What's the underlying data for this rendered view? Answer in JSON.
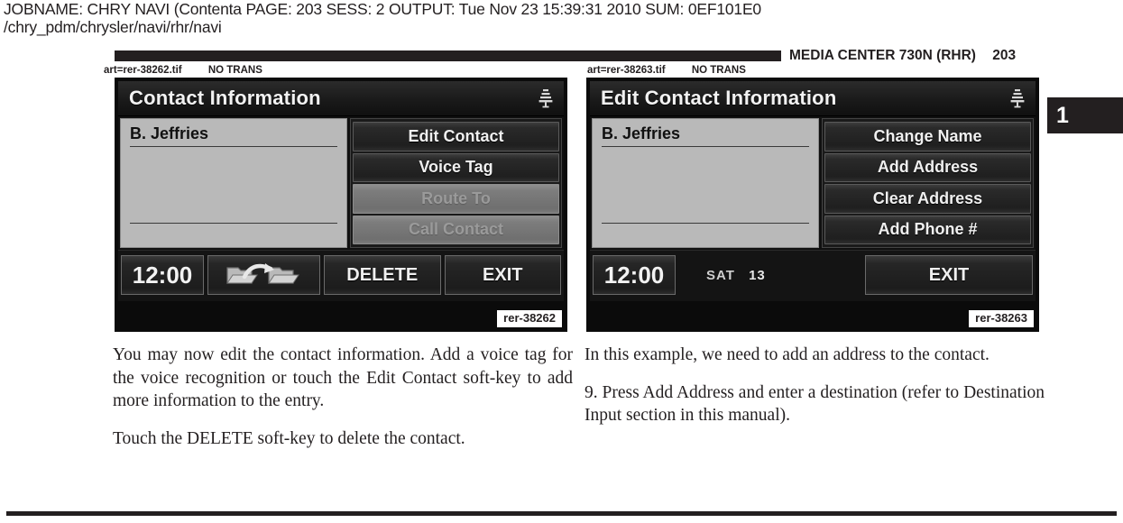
{
  "job_header": {
    "line1": "JOBNAME: CHRY NAVI (Contenta   PAGE: 203  SESS: 2  OUTPUT: Tue Nov 23 15:39:31 2010  SUM: 0EF101E0",
    "line2": "/chry_pdm/chrysler/navi/rhr/navi"
  },
  "running_head": {
    "title": "MEDIA CENTER 730N (RHR)",
    "page_number": "203"
  },
  "chapter_tab": {
    "number": "1"
  },
  "art_tags": {
    "left": {
      "file": "art=rer-38262.tif",
      "trans": "NO TRANS"
    },
    "right": {
      "file": "art=rer-38263.tif",
      "trans": "NO TRANS"
    }
  },
  "figures": [
    {
      "id": "rer-38262",
      "screen": {
        "title": "Contact Information",
        "status_icon": "radio-tower-icon",
        "contact_name": "B. Jeffries",
        "softkeys": [
          {
            "label": "Edit Contact",
            "enabled": true
          },
          {
            "label": "Voice Tag",
            "enabled": true
          },
          {
            "label": "Route To",
            "enabled": false
          },
          {
            "label": "Call Contact",
            "enabled": false
          }
        ],
        "footer": {
          "clock": "12:00",
          "icon": "transfer-folders-icon",
          "buttons": [
            {
              "label": "DELETE"
            },
            {
              "label": "EXIT"
            }
          ]
        }
      }
    },
    {
      "id": "rer-38263",
      "screen": {
        "title": "Edit Contact Information",
        "status_icon": "radio-tower-icon",
        "contact_name": "B. Jeffries",
        "softkeys": [
          {
            "label": "Change Name",
            "enabled": true
          },
          {
            "label": "Add Address",
            "enabled": true
          },
          {
            "label": "Clear Address",
            "enabled": true
          },
          {
            "label": "Add Phone #",
            "enabled": true
          }
        ],
        "footer": {
          "clock": "12:00",
          "band": "SAT",
          "channel": "13",
          "buttons": [
            {
              "label": "EXIT"
            }
          ]
        }
      }
    }
  ],
  "body": {
    "left_column": [
      "You may now edit the contact information. Add a voice tag for the voice recognition or touch the Edit Contact soft-key to add more information to the entry.",
      "Touch the DELETE soft-key to delete the contact."
    ],
    "right_column": [
      "In this example, we need to add an address to the contact.",
      "9. Press Add Address and enter a destination (refer to Destination Input section in this manual)."
    ]
  }
}
